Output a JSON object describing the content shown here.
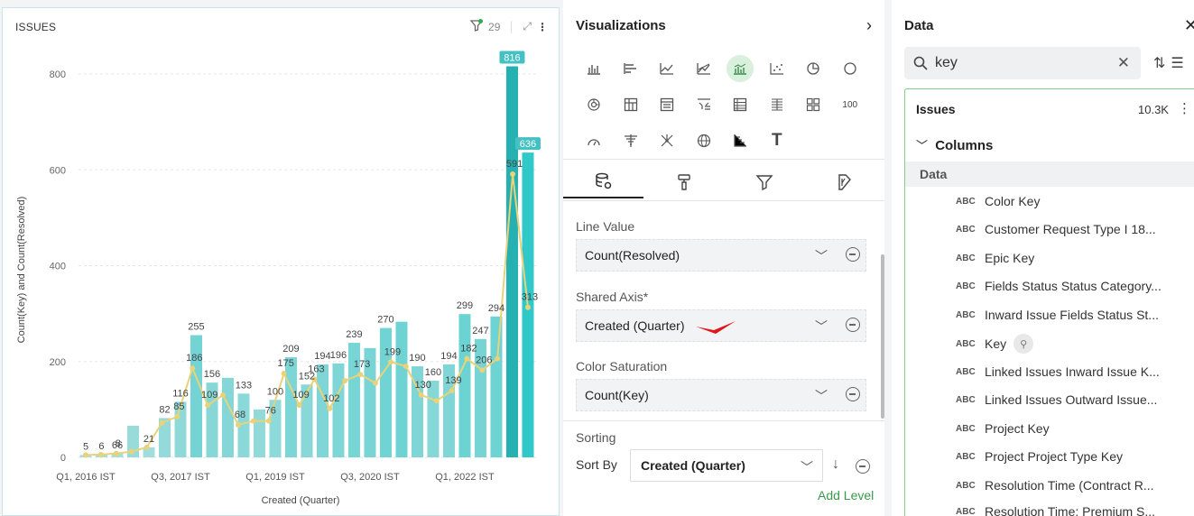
{
  "chart_panel": {
    "title": "ISSUES",
    "filter_count": "29"
  },
  "chart_data": {
    "type": "bar",
    "title": "ISSUES",
    "xlabel": "Created (Quarter)",
    "ylabel": "Count(Key) and Count(Resolved)",
    "ylim": [
      0,
      850
    ],
    "yticks": [
      0,
      200,
      400,
      600,
      800
    ],
    "x_tick_labels": [
      "Q1, 2016 IST",
      "Q3, 2017 IST",
      "Q1, 2019 IST",
      "Q3, 2020 IST",
      "Q1, 2022 IST"
    ],
    "series": [
      {
        "name": "Count(Key)",
        "type": "bar",
        "values": [
          5,
          6,
          8,
          66,
          21,
          82,
          116,
          255,
          156,
          166,
          133,
          100,
          120,
          209,
          152,
          194,
          196,
          239,
          228,
          270,
          283,
          190,
          160,
          194,
          299,
          247,
          294,
          816,
          636
        ],
        "labels": [
          "5",
          "6",
          "66",
          "",
          "21",
          "82",
          "116",
          "255",
          "156",
          "",
          "133",
          "",
          "100",
          "209",
          "152",
          "194",
          "196",
          "239",
          "",
          "270",
          "",
          "190",
          "160",
          "194",
          "299",
          "247",
          "294",
          "816",
          "636"
        ]
      },
      {
        "name": "Count(Resolved)",
        "type": "line",
        "values": [
          5,
          6,
          8,
          12,
          21,
          72,
          85,
          186,
          109,
          130,
          68,
          76,
          76,
          175,
          109,
          163,
          102,
          160,
          173,
          155,
          199,
          190,
          130,
          118,
          139,
          206,
          182,
          206,
          591,
          313
        ],
        "labels": [
          "",
          "",
          "8",
          "",
          "",
          "",
          "85",
          "186",
          "109",
          "",
          "68",
          "",
          "76",
          "175",
          "109",
          "163",
          "102",
          "",
          "173",
          "",
          "199",
          "",
          "130",
          "",
          "139",
          "182",
          "206",
          "",
          "591",
          "313"
        ]
      }
    ]
  },
  "visualizations": {
    "title": "Visualizations",
    "icons_row1": [
      "bar-chart",
      "hbar-chart",
      "line-chart",
      "area-chart",
      "combo-chart",
      "scatter-chart",
      "pie-chart",
      "donut-chart"
    ],
    "icons_row2": [
      "sunburst-chart",
      "pivot-table",
      "table-chart",
      "filter-table",
      "list-table",
      "sheet-table",
      "card-grid",
      "number-card"
    ],
    "number_label": "100",
    "icons_row3": [
      "gauge-chart",
      "funnel-chart",
      "network-chart",
      "geo-map",
      "waterfall-chart",
      "text-widget"
    ],
    "tabs": [
      "data-tab",
      "format-tab",
      "filter-tab",
      "analytics-tab"
    ],
    "line_value_label": "Line Value",
    "line_value": "Count(Resolved)",
    "shared_axis_label": "Shared Axis*",
    "shared_axis": "Created (Quarter)",
    "color_saturation_label": "Color Saturation",
    "color_saturation": "Count(Key)",
    "sorting_label": "Sorting",
    "sort_by_label": "Sort By",
    "sort_by_value": "Created (Quarter)",
    "add_level": "Add Level"
  },
  "data_panel": {
    "title": "Data",
    "search_value": "key",
    "source_name": "Issues",
    "source_count": "10.3K",
    "columns_label": "Columns",
    "data_section": "Data",
    "type_tag": "ABC",
    "columns": [
      "Color Key",
      "Customer Request Type I 18...",
      "Epic Key",
      "Fields Status Status Category...",
      "Inward Issue Fields Status St...",
      "Key",
      "Linked Issues Inward Issue K...",
      "Linked Issues Outward Issue...",
      "Project Key",
      "Project Project Type Key",
      "Resolution Time (Contract R...",
      "Resolution Time: Premium S..."
    ]
  }
}
